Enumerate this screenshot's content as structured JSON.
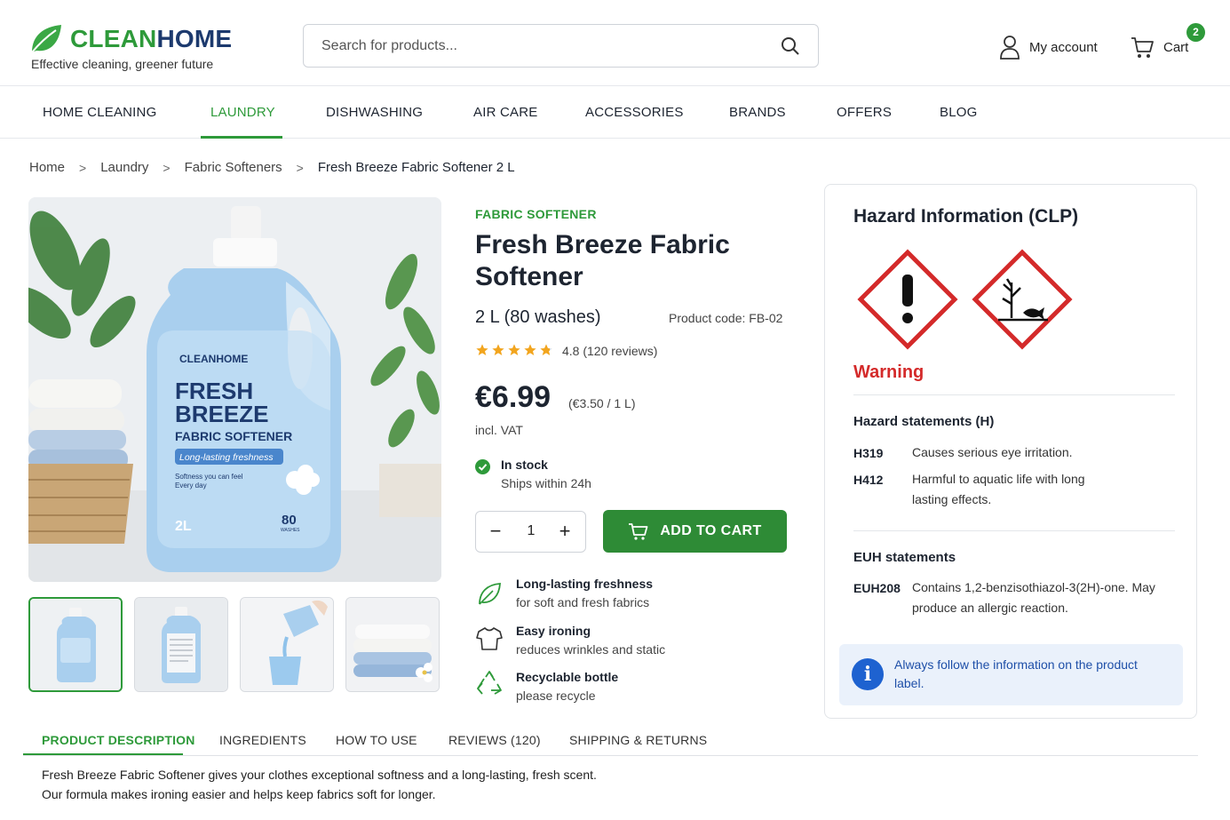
{
  "brand": {
    "name_a": "CLEAN",
    "name_b": "HOME",
    "tagline": "Effective cleaning, greener future"
  },
  "search": {
    "placeholder": "Search for products..."
  },
  "header": {
    "account_label": "My account",
    "cart_label": "Cart",
    "cart_count": "2"
  },
  "nav": {
    "items": [
      "HOME CLEANING",
      "LAUNDRY",
      "DISHWASHING",
      "AIR CARE",
      "ACCESSORIES",
      "BRANDS",
      "OFFERS",
      "BLOG"
    ],
    "active": "LAUNDRY"
  },
  "breadcrumb": [
    "Home",
    "Laundry",
    "Fabric Softeners",
    "Fresh Breeze Fabric Softener 2 L"
  ],
  "bottle_label": {
    "brand": "CLEANHOME",
    "line1": "FRESH",
    "line2": "BREEZE",
    "line3": "FABRIC SOFTENER",
    "ribbon": "Long-lasting freshness",
    "small1": "Softness you can feel",
    "small2": "Every day",
    "volume": "2L",
    "washes": "80",
    "washes_unit": "WASHES"
  },
  "product": {
    "category": "FABRIC SOFTENER",
    "title": "Fresh Breeze Fabric Softener",
    "size": "2 L (80 washes)",
    "code": "Product code: FB-02",
    "rating": 4.8,
    "rating_text": "4.8 (120 reviews)",
    "price": "€6.99",
    "unit_price": "(€3.50 / 1 L)",
    "vat": "incl. VAT",
    "stock": "In stock",
    "ships": "Ships within 24h",
    "quantity": "1",
    "add_to_cart": "ADD TO CART"
  },
  "features": [
    {
      "icon": "leaf-icon",
      "title": "Long-lasting freshness",
      "sub": "for soft and fresh fabrics"
    },
    {
      "icon": "shirt-icon",
      "title": "Easy ironing",
      "sub": "reduces wrinkles and static"
    },
    {
      "icon": "recycle-icon",
      "title": "Recyclable bottle",
      "sub": "please recycle"
    }
  ],
  "hazard": {
    "title": "Hazard Information (CLP)",
    "signal": "Warning",
    "pictograms": [
      "exclamation-mark-pictogram",
      "environment-pictogram"
    ],
    "h_heading": "Hazard statements (H)",
    "h_statements": [
      {
        "code": "H319",
        "text": "Causes serious eye irritation."
      },
      {
        "code": "H412",
        "text": "Harmful to aquatic life with long lasting effects."
      }
    ],
    "euh_heading": "EUH statements",
    "euh_statements": [
      {
        "code": "EUH208",
        "text": "Contains 1,2-benzisothiazol-3(2H)-one. May produce an allergic reaction."
      }
    ],
    "info": "Always follow the information on the product label."
  },
  "tabs": {
    "items": [
      "PRODUCT DESCRIPTION",
      "INGREDIENTS",
      "HOW TO USE",
      "REVIEWS (120)",
      "SHIPPING & RETURNS"
    ],
    "active": "PRODUCT DESCRIPTION"
  },
  "description": {
    "line1": "Fresh Breeze Fabric Softener gives your clothes exceptional softness and a long-lasting, fresh scent.",
    "line2": "Our formula makes ironing easier and helps keep fabrics soft for longer."
  },
  "colors": {
    "accent": "#2e9a3a",
    "navy": "#1d3a6e",
    "hazard_red": "#d42a2a",
    "info_blue": "#1e62d0"
  }
}
